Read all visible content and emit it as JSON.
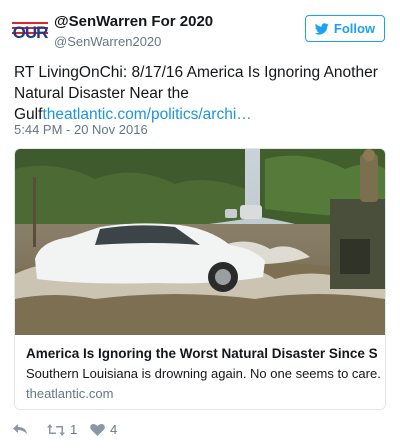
{
  "header": {
    "avatar_logo": "OUR",
    "display_name": "@SenWarren For 2020",
    "handle": "@SenWarren2020",
    "follow_label": "Follow"
  },
  "tweet": {
    "text_plain": "RT LivingOnChi: 8/17/16 America Is Ignoring Another Natural Disaster Near the Gulf",
    "link_text": "theatlantic.com/politics/archi…",
    "timestamp": "5:44 PM - 20 Nov 2016"
  },
  "card": {
    "title": "America Is Ignoring the Worst Natural Disaster Since Sup...",
    "description": "Southern Louisiana is drowning again. No one seems to care.",
    "domain": "theatlantic.com"
  },
  "actions": {
    "retweet_count": "1",
    "like_count": "4"
  },
  "colors": {
    "accent": "#1da1f2",
    "link": "#1b95e0",
    "muted": "#657786",
    "card_border": "#e1e8ed"
  }
}
